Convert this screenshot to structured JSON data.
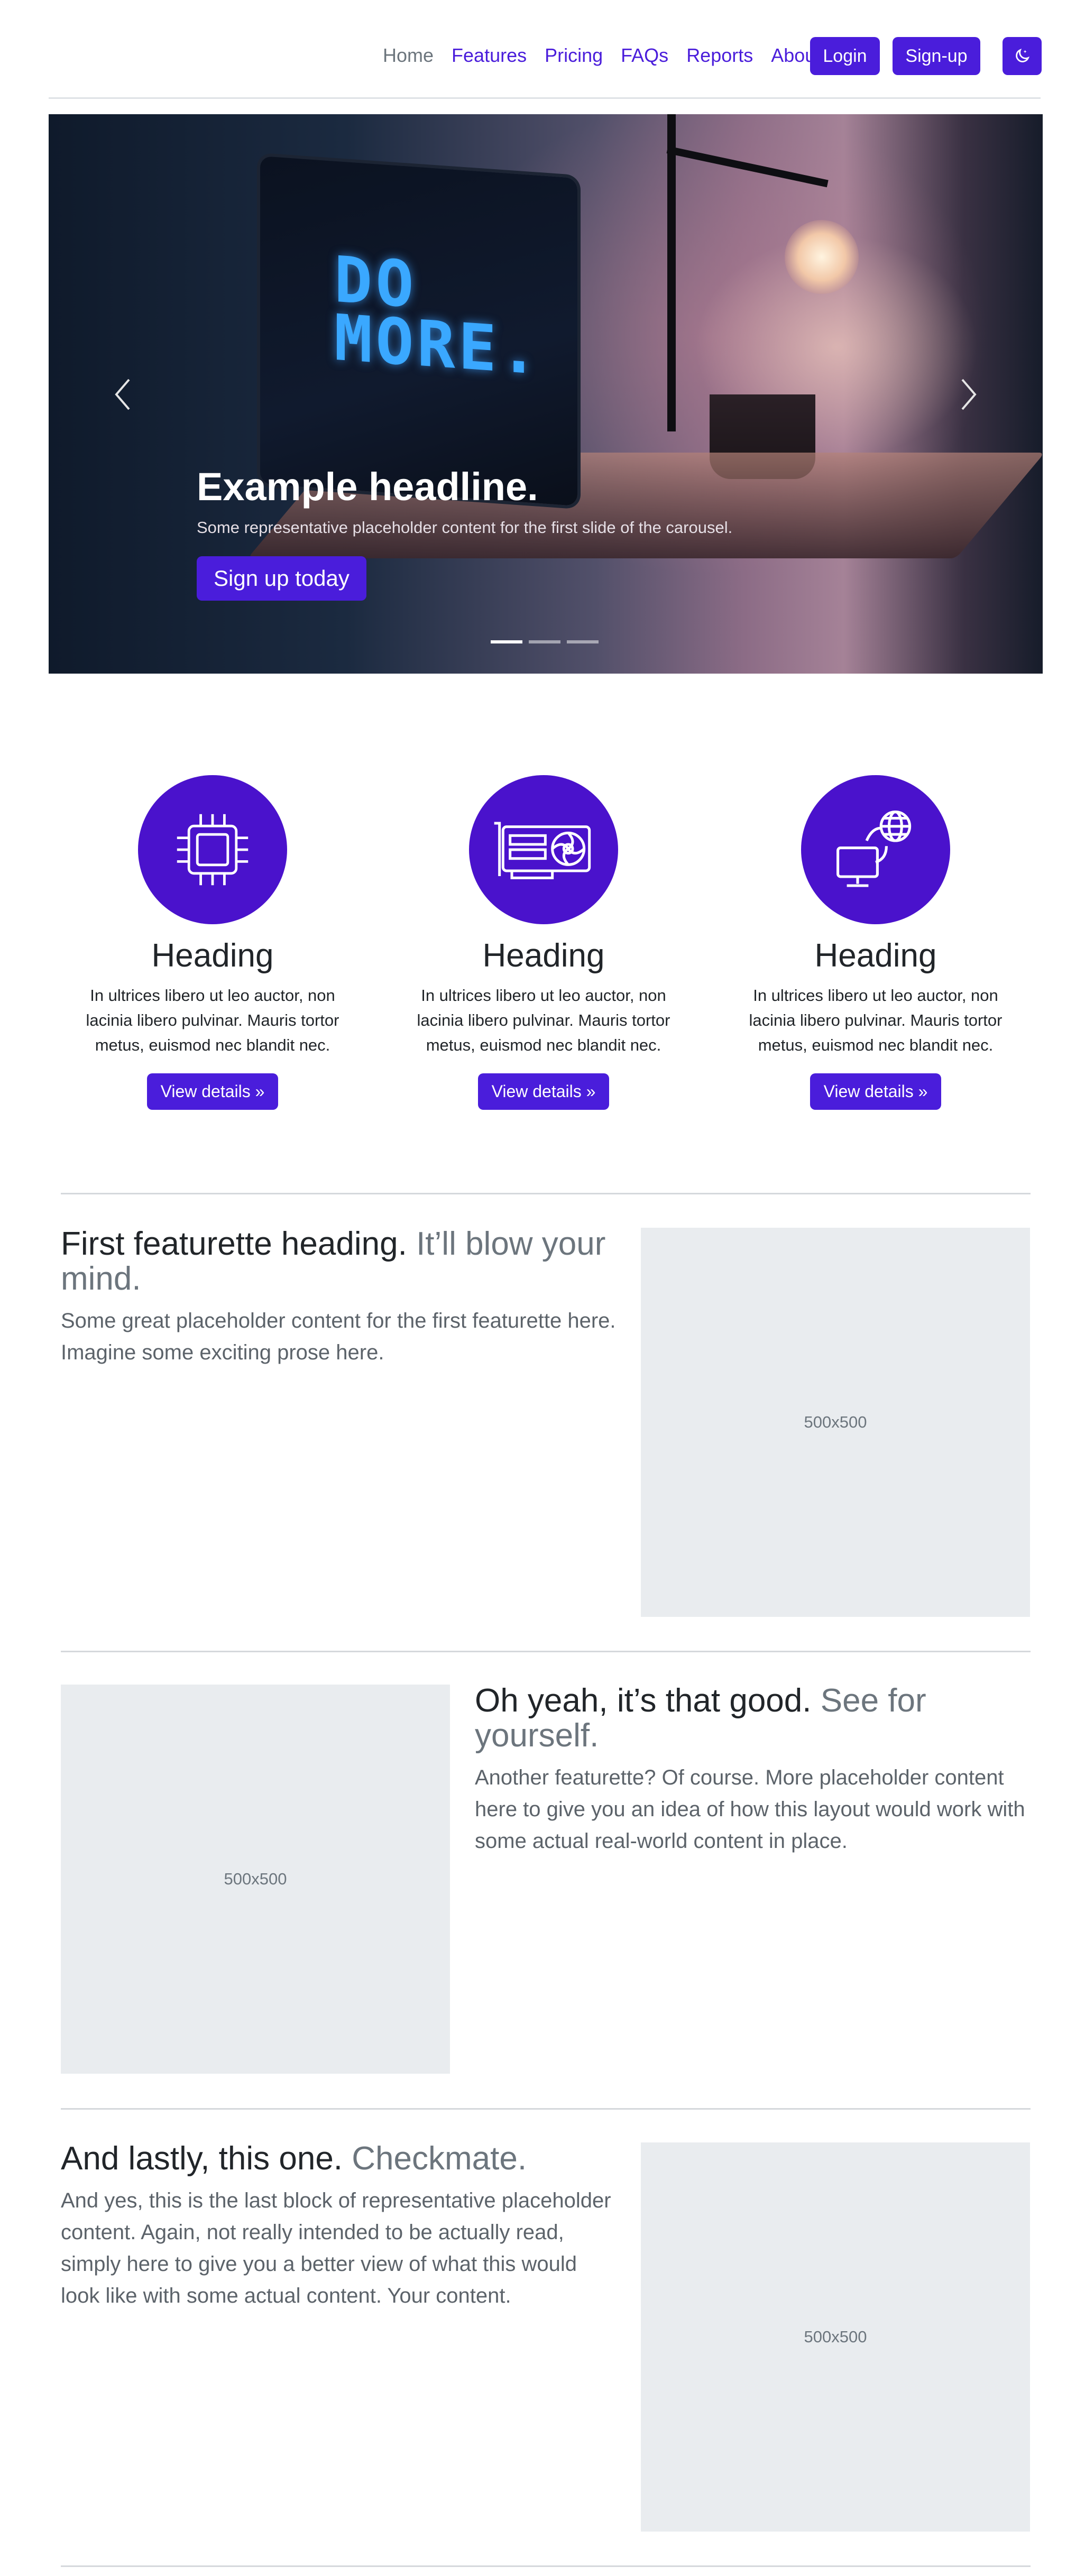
{
  "nav": {
    "links": [
      "Home",
      "Features",
      "Pricing",
      "FAQs",
      "Reports",
      "About"
    ],
    "login": "Login",
    "signup": "Sign-up",
    "theme_icon": "moon-icon"
  },
  "carousel": {
    "headline": "Example headline.",
    "text": "Some representative placeholder content for the first slide of the carousel.",
    "button": "Sign up today",
    "screen_text_line1": "DO",
    "screen_text_line2": "MORE.",
    "slides_count": 3,
    "active_slide": 1
  },
  "columns": [
    {
      "icon": "cpu-icon",
      "heading": "Heading",
      "text": "In ultrices libero ut leo auctor, non lacinia libero pulvinar. Mauris tortor metus, euismod nec blandit nec.",
      "button": "View details »"
    },
    {
      "icon": "gpu-card-icon",
      "heading": "Heading",
      "text": "In ultrices libero ut leo auctor, non lacinia libero pulvinar. Mauris tortor metus, euismod nec blandit nec.",
      "button": "View details »"
    },
    {
      "icon": "pc-display-globe-icon",
      "heading": "Heading",
      "text": "In ultrices libero ut leo auctor, non lacinia libero pulvinar. Mauris tortor metus, euismod nec blandit nec.",
      "button": "View details »"
    }
  ],
  "featurettes": [
    {
      "heading": "First featurette heading.",
      "muted": "It’ll blow your mind.",
      "text": "Some great placeholder content for the first featurette here. Imagine some exciting prose here.",
      "image_label": "500x500"
    },
    {
      "heading": "Oh yeah, it’s that good.",
      "muted": "See for yourself.",
      "text": "Another featurette? Of course. More placeholder content here to give you an idea of how this layout would work with some actual real-world content in place.",
      "image_label": "500x500"
    },
    {
      "heading": "And lastly, this one.",
      "muted": "Checkmate.",
      "text": "And yes, this is the last block of representative placeholder content. Again, not really intended to be actually read, simply here to give you a better view of what this would look like with some actual content. Your content.",
      "image_label": "500x500"
    }
  ],
  "colors": {
    "primary": "#4a1ddb",
    "circle": "#4a12cc",
    "placeholder_bg": "#e9ecef"
  }
}
